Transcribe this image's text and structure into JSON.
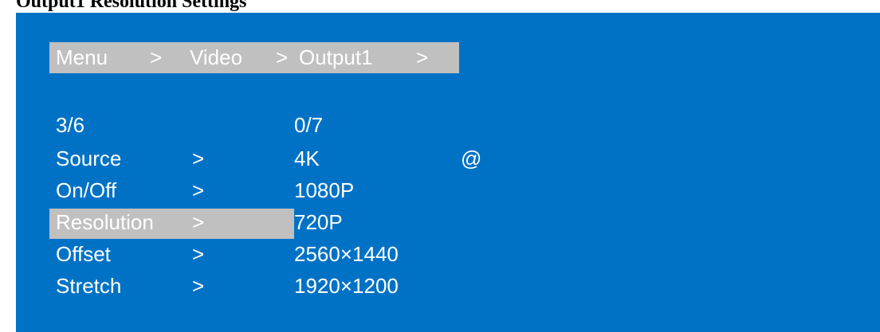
{
  "caption": "Output1 Resolution Settings",
  "colors": {
    "screen_background": "#0072c6",
    "highlight": "#c0c0c0",
    "text": "#ffffff"
  },
  "breadcrumb": {
    "menu": "Menu",
    "sep1": ">",
    "video": "Video",
    "sep2": ">",
    "output": "Output1",
    "sep3": ">"
  },
  "menu": {
    "counter": "3/6",
    "items": [
      {
        "label": "Source",
        "arrow": ">"
      },
      {
        "label": "On/Off",
        "arrow": ">"
      },
      {
        "label": "Resolution",
        "arrow": ">",
        "selected": true
      },
      {
        "label": "Offset",
        "arrow": ">"
      },
      {
        "label": "Stretch",
        "arrow": ">"
      }
    ]
  },
  "options": {
    "counter": "0/7",
    "items": [
      {
        "label": "4K",
        "current_marker": "@"
      },
      {
        "label": "1080P"
      },
      {
        "label": "720P",
        "selected": true
      },
      {
        "label": "2560×1440"
      },
      {
        "label": "1920×1200"
      }
    ]
  }
}
